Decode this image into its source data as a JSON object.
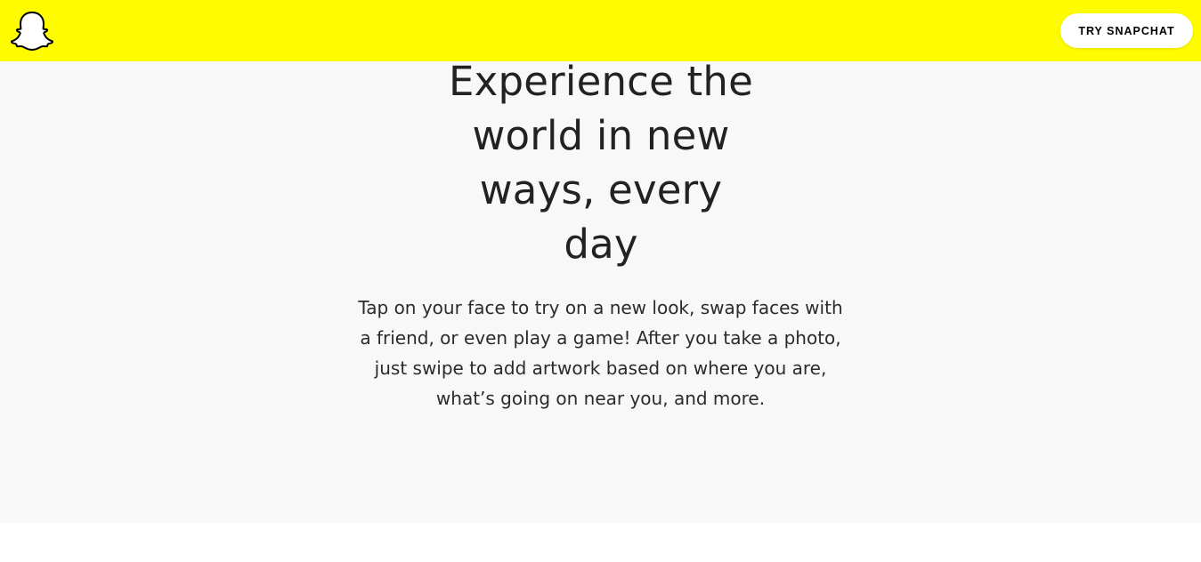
{
  "header": {
    "cta_label": "TRY SNAPCHAT",
    "background_color": "#FFFC00",
    "logo_icon": "ghost-icon"
  },
  "hero": {
    "headline_lines": [
      "Experience the",
      "world in new",
      "ways, every",
      "day"
    ],
    "body": "Tap on your face to try on a new look, swap faces with a friend, or even play a game! After you take a photo, just swipe to add artwork based on where you are, what’s going on near you, and more.",
    "background_color": "#F8F8F8"
  }
}
